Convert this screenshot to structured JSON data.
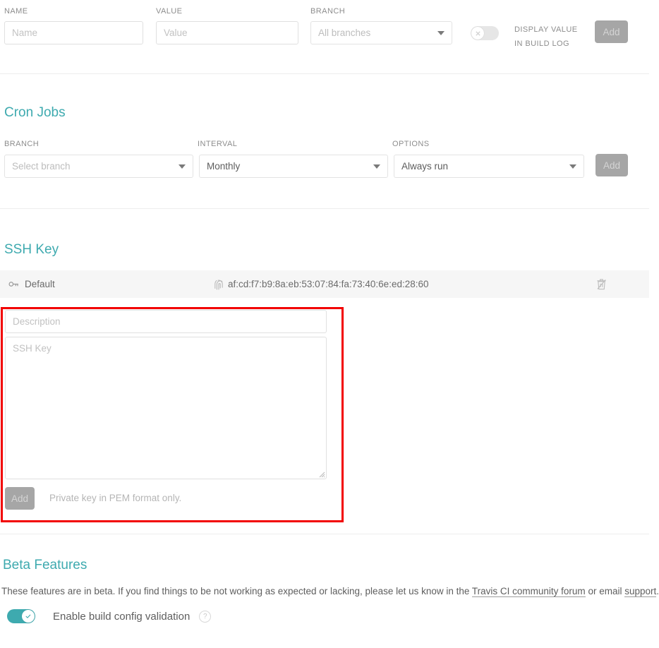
{
  "env_vars": {
    "labels": {
      "name": "NAME",
      "value": "VALUE",
      "branch": "BRANCH"
    },
    "name_placeholder": "Name",
    "value_placeholder": "Value",
    "branch_selected": "All branches",
    "display_toggle": {
      "state": "off",
      "line1": "DISPLAY VALUE",
      "line2": "IN BUILD LOG",
      "icon": "close-x-icon"
    },
    "add_label": "Add"
  },
  "cron_jobs": {
    "title": "Cron Jobs",
    "labels": {
      "branch": "BRANCH",
      "interval": "INTERVAL",
      "options": "OPTIONS"
    },
    "branch_selected": "Select branch",
    "interval_selected": "Monthly",
    "options_selected": "Always run",
    "add_label": "Add"
  },
  "ssh_key": {
    "title": "SSH Key",
    "row": {
      "key_icon": "key-icon",
      "name": "Default",
      "fingerprint_icon": "fingerprint-icon",
      "fingerprint": "af:cd:f7:b9:8a:eb:53:07:84:fa:73:40:6e:ed:28:60",
      "delete_icon": "trash-disabled-icon"
    },
    "description_placeholder": "Description",
    "key_placeholder": "SSH Key",
    "add_label": "Add",
    "hint": "Private key in PEM format only."
  },
  "beta_features": {
    "title": "Beta Features",
    "paragraph_part1": "These features are in beta. If you find things to be not working as expected or lacking, please let us know in the ",
    "link_forum": "Travis CI community forum",
    "paragraph_part2": " or email ",
    "link_support": "support",
    "paragraph_part3": ".",
    "toggle": {
      "state": "on",
      "label": "Enable build config validation",
      "help": "?",
      "icon": "check-icon"
    }
  },
  "colors": {
    "accent_teal": "#3eaaaf",
    "highlight_red": "#f20000",
    "disabled_button": "#a6a6a6",
    "row_background": "#f6f6f6"
  }
}
